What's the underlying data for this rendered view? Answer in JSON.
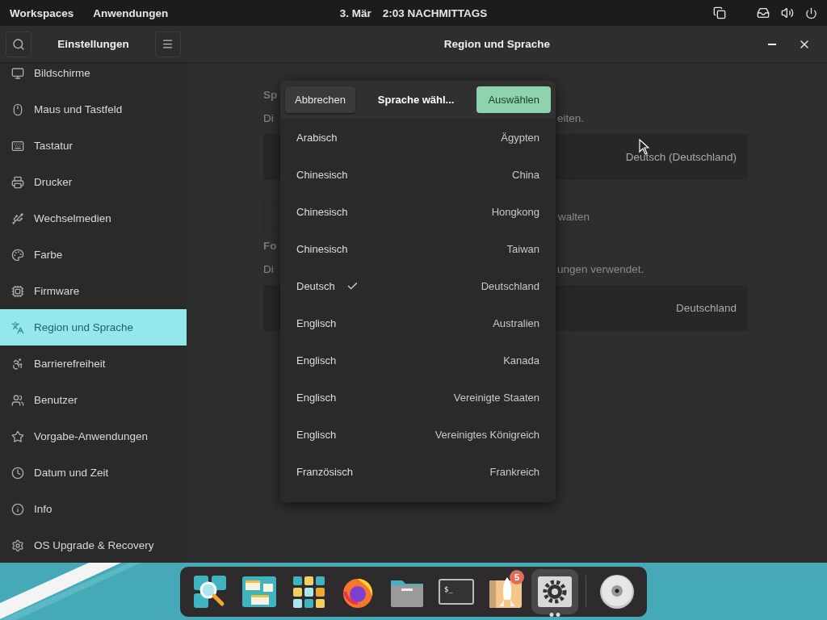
{
  "top_bar": {
    "items": [
      "Workspaces",
      "Anwendungen"
    ],
    "date": "3. Mär",
    "time": "2:03 NACHMITTAGS"
  },
  "window": {
    "title": "Region und Sprache",
    "sidebar_title": "Einstellungen"
  },
  "sidebar": {
    "items": [
      {
        "label": "Bildschirme",
        "selected": false
      },
      {
        "label": "Maus und Tastfeld",
        "selected": false
      },
      {
        "label": "Tastatur",
        "selected": false
      },
      {
        "label": "Drucker",
        "selected": false
      },
      {
        "label": "Wechselmedien",
        "selected": false
      },
      {
        "label": "Farbe",
        "selected": false
      },
      {
        "label": "Firmware",
        "selected": false
      },
      {
        "label": "Region und Sprache",
        "selected": true
      },
      {
        "label": "Barrierefreiheit",
        "selected": false
      },
      {
        "label": "Benutzer",
        "selected": false
      },
      {
        "label": "Vorgabe-Anwendungen",
        "selected": false
      },
      {
        "label": "Datum und Zeit",
        "selected": false
      },
      {
        "label": "Info",
        "selected": false
      },
      {
        "label": "OS Upgrade & Recovery",
        "selected": false
      }
    ]
  },
  "content": {
    "sections": [
      {
        "heading": "Sp",
        "description_start": "Di",
        "description_end": "eiten.",
        "rows": [
          {
            "kind": "value",
            "value": "Deutsch (Deutschland)"
          },
          {
            "kind": "button",
            "label_end": "walten"
          }
        ]
      },
      {
        "heading": "Fo",
        "description_start": "Di",
        "description_end": "ungen verwendet.",
        "rows": [
          {
            "kind": "value",
            "value": "Deutschland"
          }
        ]
      }
    ]
  },
  "dialog": {
    "cancel": "Abbrechen",
    "title": "Sprache wähl...",
    "confirm": "Auswählen",
    "rows": [
      {
        "language": "Arabisch",
        "region": "Ägypten",
        "checked": false
      },
      {
        "language": "Chinesisch",
        "region": "China",
        "checked": false
      },
      {
        "language": "Chinesisch",
        "region": "Hongkong",
        "checked": false
      },
      {
        "language": "Chinesisch",
        "region": "Taiwan",
        "checked": false
      },
      {
        "language": "Deutsch",
        "region": "Deutschland",
        "checked": true
      },
      {
        "language": "Englisch",
        "region": "Australien",
        "checked": false
      },
      {
        "language": "Englisch",
        "region": "Kanada",
        "checked": false
      },
      {
        "language": "Englisch",
        "region": "Vereinigte Staaten",
        "checked": false
      },
      {
        "language": "Englisch",
        "region": "Vereinigtes Königreich",
        "checked": false
      },
      {
        "language": "Französisch",
        "region": "Frankreich",
        "checked": false
      }
    ]
  },
  "dock": {
    "apps": [
      {
        "kind": "search",
        "selected": false
      },
      {
        "kind": "workspaces",
        "selected": false
      },
      {
        "kind": "apps",
        "selected": false
      },
      {
        "kind": "browser",
        "selected": false
      },
      {
        "kind": "files",
        "selected": false
      },
      {
        "kind": "terminal",
        "glyph": "$_",
        "selected": false
      },
      {
        "kind": "launcher",
        "badge": "5",
        "selected": false
      },
      {
        "kind": "settings",
        "selected": true
      }
    ],
    "devices": [
      {
        "kind": "disc",
        "selected": false
      }
    ]
  }
}
